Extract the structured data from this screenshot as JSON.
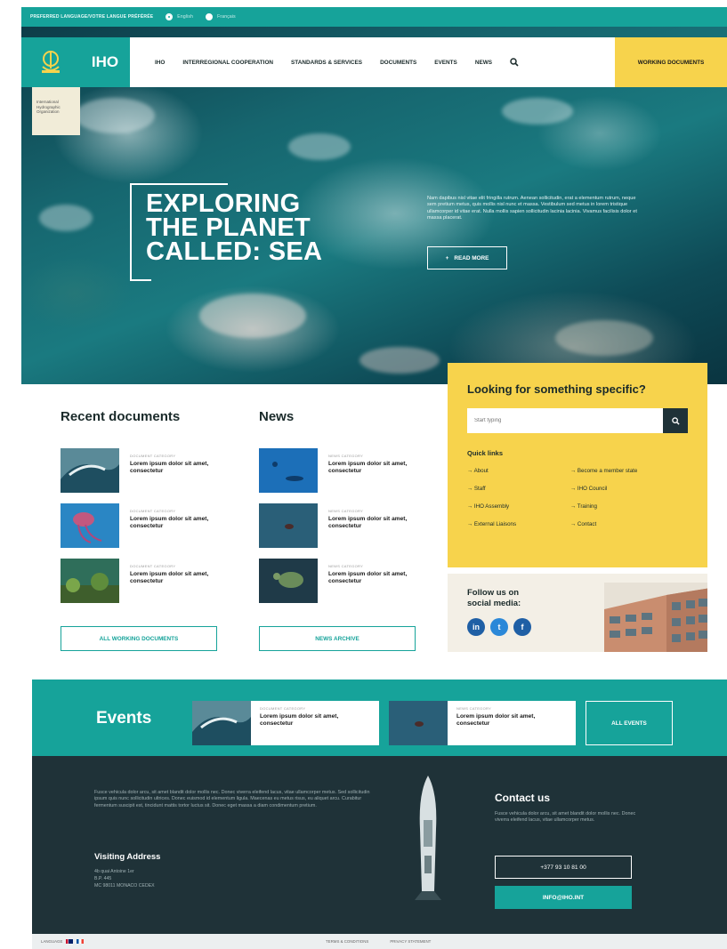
{
  "langbar": {
    "label": "PREFERRED LANGUAGE/VOTRE LANGUE PRÉFÉRÉE",
    "options": [
      "English",
      "Français"
    ],
    "selected": "English"
  },
  "nav": {
    "logo_text": "IHO",
    "links": [
      "IHO",
      "INTERREGIONAL COOPERATION",
      "STANDARDS & SERVICES",
      "DOCUMENTS",
      "EVENTS",
      "NEWS"
    ],
    "cta": "WORKING DOCUMENTS",
    "org_label": "International Hydrographic Organization"
  },
  "hero": {
    "title_lines": [
      "EXPLORING",
      "THE PLANET",
      "CALLED: SEA"
    ],
    "text": "Nam dapibus nisl vitae elit fringilla rutrum. Aenean sollicitudin, erat a elementum rutrum, neque sem pretium metus, quis mollis nisl nunc et massa. Vestibulum sed metus in lorem tristique ullamcorper id vitae erat. Nulla mollis sapien sollicitudin lacinia lacinia. Vivamus facilisis dolor et massa placerat.",
    "read_more": "READ MORE"
  },
  "recent_documents": {
    "title": "Recent documents",
    "items": [
      {
        "category": "DOCUMENT CATEGORY",
        "title": "Lorem ipsum dolor sit amet, consectetur"
      },
      {
        "category": "DOCUMENT CATEGORY",
        "title": "Lorem ipsum dolor sit amet, consectetur"
      },
      {
        "category": "DOCUMENT CATEGORY",
        "title": "Lorem ipsum dolor sit amet, consectetur"
      }
    ],
    "button": "ALL WORKING DOCUMENTS"
  },
  "news": {
    "title": "News",
    "items": [
      {
        "category": "NEWS CATEGORY",
        "title": "Lorem ipsum dolor sit amet, consectetur"
      },
      {
        "category": "NEWS CATEGORY",
        "title": "Lorem ipsum dolor sit amet, consectetur"
      },
      {
        "category": "NEWS CATEGORY",
        "title": "Lorem ipsum dolor sit amet, consectetur"
      }
    ],
    "button": "NEWS ARCHIVE"
  },
  "search_panel": {
    "title": "Looking for something specific?",
    "placeholder": "Start typing",
    "quick_links_title": "Quick links",
    "quick_links": [
      "About",
      "Become a member state",
      "Staff",
      "IHO Council",
      "IHO Assembly",
      "Training",
      "External Liaisons",
      "Contact"
    ]
  },
  "social": {
    "label_line1": "Follow us on",
    "label_line2": "social media:",
    "icons": [
      "in",
      "t",
      "f"
    ]
  },
  "events": {
    "title": "Events",
    "cards": [
      {
        "category": "DOCUMENT CATEGORY",
        "title": "Lorem ipsum dolor sit amet, consectetur"
      },
      {
        "category": "NEWS CATEGORY",
        "title": "Lorem ipsum dolor sit amet, consectetur"
      }
    ],
    "button": "ALL EVENTS"
  },
  "footer": {
    "text": "Fusce vehicula dolor arcu, sit amet blandit dolor mollis nec. Donec viverra eleifend lacus, vitae ullamcorper metus. Sed sollicitudin ipsum quis nunc sollicitudin ultrices. Donec euismod id elementum ligula. Maecenas eu metus risus, eu aliquet arcu. Curabitur fermentum suscipit est, tincidunt mattis tortor luctus sit. Donec eget massa a diam condimentum pretium.",
    "visit_title": "Visiting Address",
    "visit_lines": [
      "4b quai Antoine 1er",
      "B.P. 445",
      "MC 98011 MONACO CEDEX"
    ],
    "contact_title": "Contact us",
    "contact_text": "Fusce vehicula dolor arcu, sit amet blandit dolor mollis nec. Donec viverra eleifend lacus, vitae ullamcorper metus.",
    "phone": "+377 93 10 81 00",
    "email": "INFO@IHO.INT"
  },
  "bottom_bar": {
    "language_label": "LANGUAGE",
    "links": [
      "TERMS & CONDITIONS",
      "PRIVACY STATEMENT"
    ]
  },
  "colors": {
    "teal": "#16a39a",
    "yellow": "#f7d34c",
    "dark": "#1f3238"
  }
}
